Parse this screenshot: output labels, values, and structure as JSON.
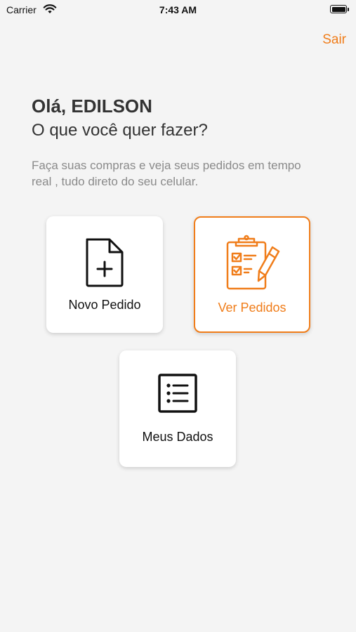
{
  "status_bar": {
    "carrier": "Carrier",
    "time": "7:43 AM"
  },
  "header": {
    "logout_label": "Sair"
  },
  "greeting": {
    "title": "Olá, EDILSON",
    "question": "O que você quer fazer?",
    "description": "Faça suas compras e veja seus pedidos em tempo real , tudo direto do seu celular."
  },
  "actions": [
    {
      "label": "Novo Pedido",
      "icon": "new-document-icon"
    },
    {
      "label": "Ver Pedidos",
      "icon": "clipboard-checklist-icon",
      "selected": true
    },
    {
      "label": "Meus Dados",
      "icon": "list-icon"
    }
  ],
  "colors": {
    "accent": "#f07d1a",
    "background": "#f4f4f4",
    "card": "#ffffff",
    "muted_text": "#8a8a8a"
  }
}
